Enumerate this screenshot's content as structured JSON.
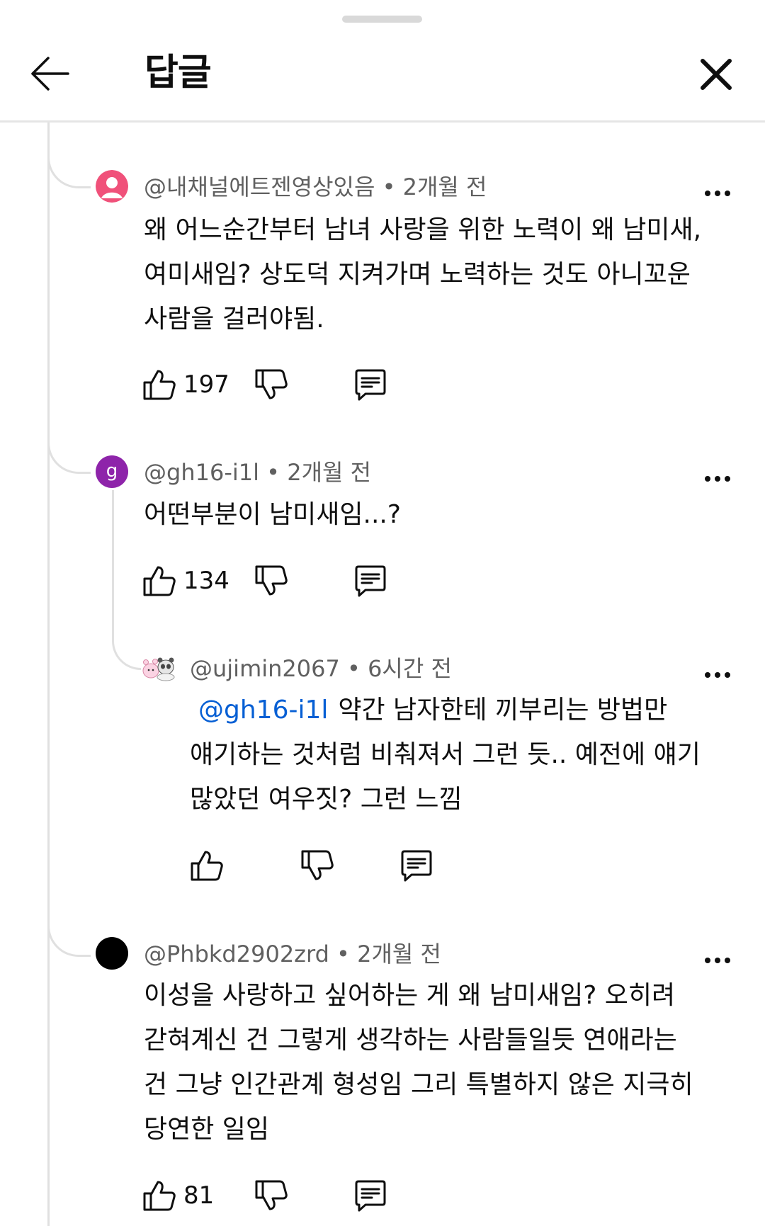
{
  "header": {
    "title": "답글"
  },
  "comments": [
    {
      "author": "@내채널에트젠영상있음",
      "time": "2개월 전",
      "text_lines": [
        "왜 어느순간부터 남녀 사랑을 위한 노력이 왜 남미새,",
        "여미새임? 상도덕 지켜가며 노력하는 것도 아니꼬운",
        "사람을 걸러야됨."
      ],
      "likes": "197",
      "avatar": {
        "icon": "person-icon",
        "color": "#f0517a"
      }
    },
    {
      "author": "@gh16-i1l",
      "time": "2개월 전",
      "text_lines": [
        "어떤부분이 남미새임...?"
      ],
      "likes": "134",
      "avatar": {
        "letter": "g",
        "color": "#8e24aa"
      }
    },
    {
      "author": "@ujimin2067",
      "time": "6시간 전",
      "mention": "@gh16-i1l",
      "text_lines": [
        "약간 남자한테 끼부리는 방법만",
        "얘기하는 것처럼 비춰져서 그런 듯.. 예전에 얘기",
        "많았던 여우짓? 그런 느낌"
      ],
      "likes": "",
      "avatar": {
        "icon": "cartoon-avatar-icon"
      }
    },
    {
      "author": "@Phbkd2902zrd",
      "time": "2개월 전",
      "text_lines": [
        "이성을 사랑하고 싶어하는 게 왜 남미새임? 오히려",
        "갇혀계신 건 그렇게 생각하는 사람들일듯 연애라는",
        "건 그냥 인간관계 형성임 그리 특별하지 않은 지극히",
        "당연한 일임"
      ],
      "likes": "81",
      "avatar": {
        "color": "#000000"
      }
    }
  ],
  "separator": "•",
  "colors": {
    "mention": "#065fd4",
    "meta": "#606060",
    "thread_line": "#e0e0e0"
  }
}
